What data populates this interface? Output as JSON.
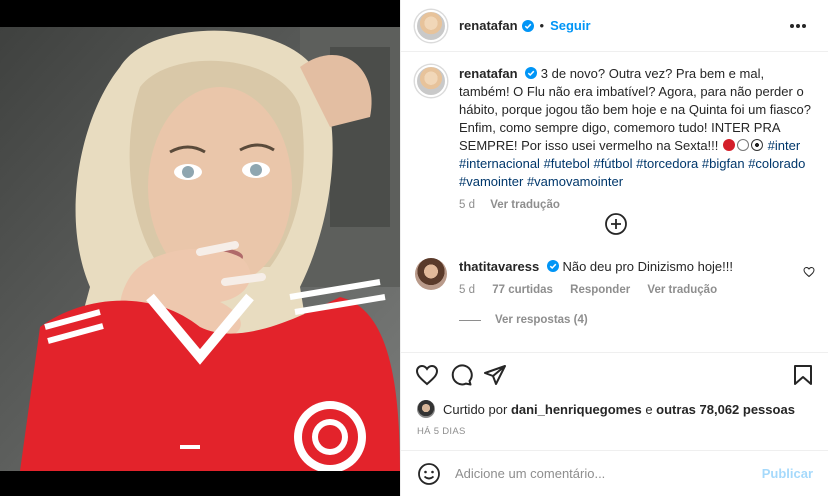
{
  "post": {
    "author": "renatafan",
    "follow_label": "Seguir",
    "separator": "•"
  },
  "caption": {
    "username": "renatafan",
    "text": "3 de novo? Outra vez? Pra bem e mal, também! O Flu não era imbatível? Agora, para não perder o hábito, porque jogou tão bem hoje e na Quinta foi um fiasco? Enfim, como sempre digo, comemoro tudo! INTER PRA SEMPRE! Por isso usei vermelho na Sexta!!!",
    "hashtags": [
      "#inter",
      "#internacional",
      "#futebol",
      "#fútbol",
      "#torcedora",
      "#bigfan",
      "#colorado",
      "#vamointer",
      "#vamovamointer"
    ],
    "time": "5 d",
    "see_translation": "Ver tradução"
  },
  "comment": {
    "username": "thatitavaress",
    "text": "Não deu pro Dinizismo hoje!!!",
    "time": "5 d",
    "likes": "77 curtidas",
    "reply": "Responder",
    "see_translation": "Ver tradução",
    "view_replies": "Ver respostas (4)"
  },
  "likes": {
    "prefix": "Curtido por",
    "user": "dani_henriquegomes",
    "connector": "e",
    "others": "outras 78,062 pessoas"
  },
  "posted_ago": "HÁ 5 DIAS",
  "add_comment": {
    "placeholder": "Adicione um comentário...",
    "post_label": "Publicar"
  },
  "colors": {
    "accent": "#0095f6",
    "hashtag": "#00376b",
    "jersey_red": "#e3232b"
  }
}
